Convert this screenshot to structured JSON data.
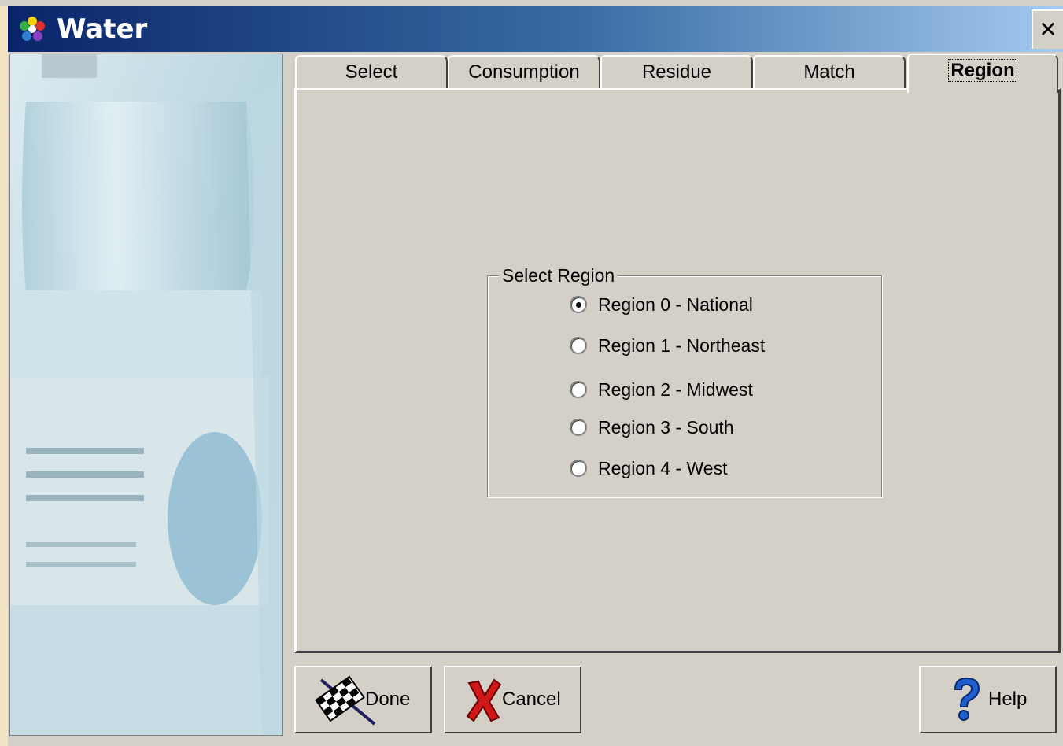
{
  "window": {
    "title": "Water",
    "close_label": "✕"
  },
  "tabs": [
    {
      "label": "Select",
      "active": false
    },
    {
      "label": "Consumption",
      "active": false
    },
    {
      "label": "Residue",
      "active": false
    },
    {
      "label": "Match",
      "active": false
    },
    {
      "label": "Region",
      "active": true
    }
  ],
  "region_group": {
    "legend": "Select Region",
    "options": [
      {
        "label": "Region 0 - National",
        "checked": true
      },
      {
        "label": "Region 1 - Northeast",
        "checked": false
      },
      {
        "label": "Region 2 - Midwest",
        "checked": false
      },
      {
        "label": "Region 3 - South",
        "checked": false
      },
      {
        "label": "Region 4 - West",
        "checked": false
      }
    ]
  },
  "buttons": {
    "done": "Done",
    "cancel": "Cancel",
    "help": "Help"
  },
  "icons": {
    "app": "flower-icon",
    "done": "checkered-flag-icon",
    "cancel": "red-x-icon",
    "help": "question-mark-icon"
  }
}
